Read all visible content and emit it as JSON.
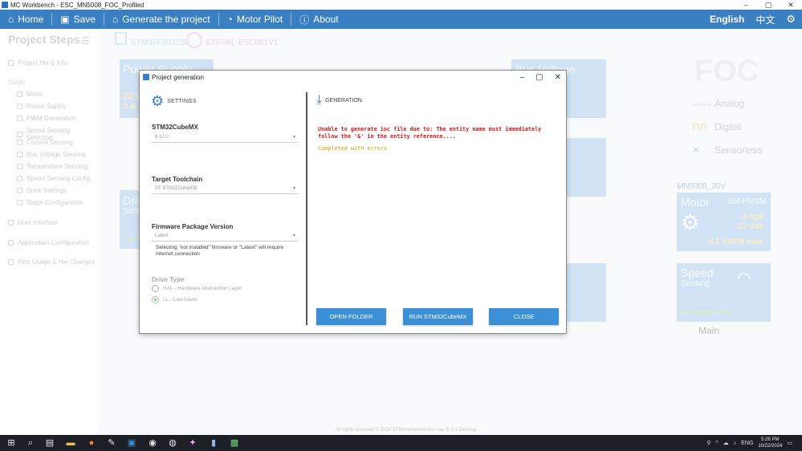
{
  "window": {
    "title": "MC Workbench - ESC_MN5008_FOC_Profiled",
    "min": "–",
    "max": "▢",
    "close": "✕"
  },
  "nav": {
    "home": "Home",
    "save": "Save",
    "generate": "Generate the project",
    "motor_pilot": "Motor Pilot",
    "about": "About",
    "lang_en": "English",
    "lang_cn": "中文"
  },
  "sidebar": {
    "title": "Project Steps",
    "stage_label": "Stage",
    "items": [
      "Project Hw & Info",
      "Motor",
      "Power Supply",
      "PWM Generation",
      "Speed Sensing Selection",
      "Current Sensing",
      "Bus Voltage Sensing",
      "Temperature Sensing",
      "Speed Sensing Config.",
      "Drive Settings",
      "Stage Configuration",
      "User Interface",
      "Application Configuration",
      "Pins Usage & Hw Changes"
    ]
  },
  "background": {
    "mcu": "STM32F303CB",
    "board": "STEVAL-ESC001V1",
    "power_supply": "Power Supply",
    "ps_v": "22 V",
    "ps_a": "3 A",
    "bus_voltage": "Bus Voltage",
    "drive": "Drive",
    "drive_sub": "Setti",
    "drive_sp": "Spe",
    "foc": "FOC",
    "analog": "Analog",
    "digital": "Digital",
    "sensorless": "Sensorless",
    "motor_name": "MN5008_20V",
    "motor": "Motor",
    "motor_type": "SM-PMSM",
    "motor_apk": "3 Apk",
    "motor_vdc": "22 Vdc",
    "motor_krpm": "4.1 kRPM max",
    "speed": "Speed",
    "sensing": "Sensing",
    "observer": "Observer PLL",
    "main": "Main",
    "footer": "All rights reserved © 2024 STMicroelectronics - ver. 6.3.1 Desktop"
  },
  "dialog": {
    "title": "Project generation",
    "settings_label": "SETTINGS",
    "generation_label": "GENERATION",
    "cubemx_title": "STM32CubeMX",
    "cubemx_value": "6.12.0",
    "toolchain_title": "Target Toolchain",
    "toolchain_value": "ST STM32CubeIDE",
    "fw_title": "Firmware Package Version",
    "fw_value": "Latest",
    "fw_hint": "Selecting \"not installed\" firmware or \"Latest\" will require internet connection",
    "drive_type_title": "Drive Type",
    "hal_label": "HAL - Hardware Abstraction Layer",
    "ll_label": "LL - Low Level",
    "log_error_1": "Unable to generate ioc file due to: The entity name must immediately",
    "log_error_2": "follow the '&' in the entity reference....",
    "log_status": "Completed with errors",
    "btn_open_folder": "OPEN FOLDER",
    "btn_run_cubemx": "RUN STM32CubeMX",
    "btn_close": "CLOSE"
  },
  "taskbar": {
    "lang": "ENG",
    "time": "5:26 PM",
    "date": "10/22/2024"
  },
  "colors": {
    "accent": "#3a7fc1",
    "button": "#3a8fd6",
    "error": "#d01a1a",
    "warning": "#d69a00",
    "panel": "#b9d4ef"
  }
}
